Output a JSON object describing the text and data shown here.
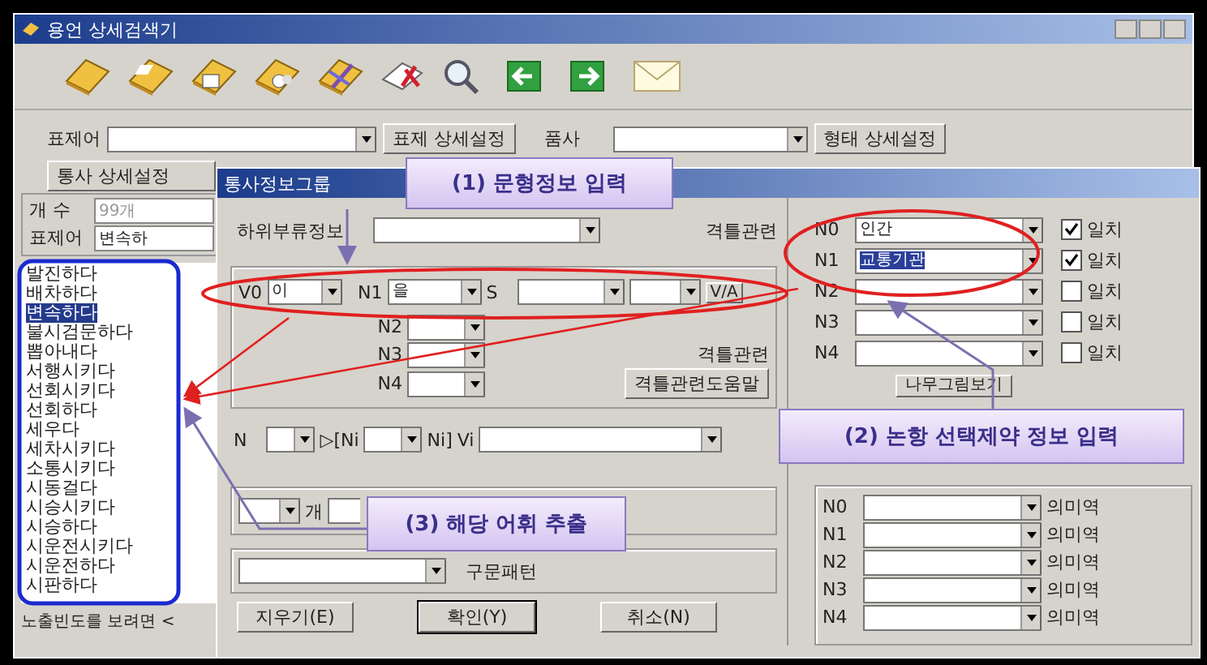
{
  "main_window": {
    "title": "용언 상세검색기"
  },
  "search_row": {
    "headword_label": "표제어",
    "headword_settings_button": "표제 상세설정",
    "pos_label": "품사",
    "form_settings_button": "형태 상세설정"
  },
  "syntax_settings_button": "통사 상세설정",
  "result_panel": {
    "count_label": "개 수",
    "count_value": "99개",
    "headword_label": "표제어",
    "headword_value": "변속하",
    "items": [
      {
        "text": "발진하다",
        "selected": false
      },
      {
        "text": "배차하다",
        "selected": false
      },
      {
        "text": "변속하다",
        "selected": true
      },
      {
        "text": "불시검문하다",
        "selected": false
      },
      {
        "text": "뽑아내다",
        "selected": false
      },
      {
        "text": "서행시키다",
        "selected": false
      },
      {
        "text": "선회시키다",
        "selected": false
      },
      {
        "text": "선회하다",
        "selected": false
      },
      {
        "text": "세우다",
        "selected": false
      },
      {
        "text": "세차시키다",
        "selected": false
      },
      {
        "text": "소통시키다",
        "selected": false
      },
      {
        "text": "시동걸다",
        "selected": false
      },
      {
        "text": "시승시키다",
        "selected": false
      },
      {
        "text": "시승하다",
        "selected": false
      },
      {
        "text": "시운전시키다",
        "selected": false
      },
      {
        "text": "시운전하다",
        "selected": false
      },
      {
        "text": "시판하다",
        "selected": false
      }
    ],
    "footer": "노출빈도를 보려면 <"
  },
  "dialog": {
    "title": "통사정보그룹",
    "subclass_label": "하위부류정보",
    "frame_label_top": "격틀관련",
    "pattern": {
      "v0_label": "V0",
      "v0_value": "이",
      "n1_label": "N1",
      "n1_value": "을",
      "s_label": "S",
      "va_button": "V/A",
      "extra_rows": [
        {
          "label": "N2"
        },
        {
          "label": "N3"
        },
        {
          "label": "N4"
        }
      ],
      "frame_label": "격틀관련",
      "frame_help_button": "격틀관련도움말"
    },
    "chain_row": {
      "n_label": "N",
      "open_label": "▷[Ni",
      "close_label": "Ni]",
      "vi_label": "Vi"
    },
    "constraints": [
      {
        "label": "N0",
        "value": "인간",
        "highlighted": false,
        "match_label": "일치",
        "checked": true
      },
      {
        "label": "N1",
        "value": "교통기관",
        "highlighted": true,
        "match_label": "일치",
        "checked": true
      },
      {
        "label": "N2",
        "highlighted": false,
        "match_label": "일치",
        "checked": false
      },
      {
        "label": "N3",
        "highlighted": false,
        "match_label": "일치",
        "checked": false
      },
      {
        "label": "N4",
        "highlighted": false,
        "match_label": "일치",
        "checked": false
      }
    ],
    "tree_button": "나무그림보기",
    "count_suffix": "개",
    "pattern_combo_label": "구문패턴",
    "roles": [
      {
        "label": "N0",
        "role_label": "의미역"
      },
      {
        "label": "N1",
        "role_label": "의미역"
      },
      {
        "label": "N2",
        "role_label": "의미역"
      },
      {
        "label": "N3",
        "role_label": "의미역"
      },
      {
        "label": "N4",
        "role_label": "의미역"
      }
    ],
    "buttons": [
      {
        "label": "지우기(E)",
        "default": false
      },
      {
        "label": "확인(Y)",
        "default": true
      },
      {
        "label": "취소(N)",
        "default": false
      }
    ]
  },
  "annotations": [
    {
      "text": "(1) 문형정보 입력"
    },
    {
      "text": "(2) 논항 선택제약 정보 입력"
    },
    {
      "text": "(3) 해당 어휘 추출"
    }
  ]
}
